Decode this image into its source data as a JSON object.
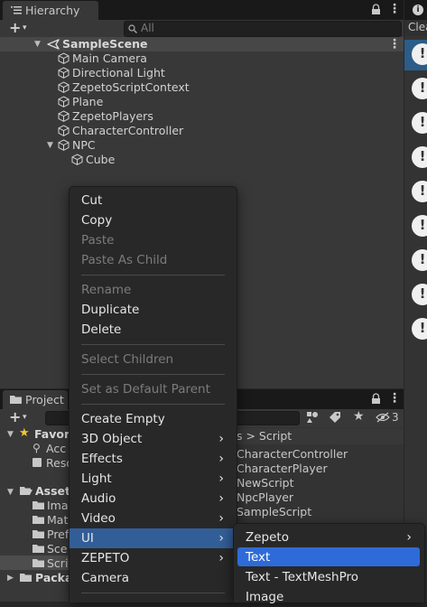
{
  "hierarchy": {
    "tab_label": "Hierarchy",
    "search_placeholder": "All",
    "scene_name": "SampleScene",
    "objects": [
      "Main Camera",
      "Directional Light",
      "ZepetoScriptContext",
      "Plane",
      "ZepetoPlayers",
      "CharacterController",
      "NPC",
      "Cube"
    ]
  },
  "inspector": {
    "header_label": "Clea"
  },
  "project": {
    "tab_label": "Project",
    "breadcrumb": "s > Script",
    "badge_count": "3",
    "left_items": [
      "Favori",
      "Acc",
      "Reso",
      "Asset",
      "Imag",
      "Mat",
      "Pref",
      "Sce",
      "Scri",
      "Packa"
    ],
    "files": [
      "CharacterController",
      "CharacterPlayer",
      "NewScript",
      "NpcPlayer",
      "SampleScript"
    ]
  },
  "context_menu": {
    "cut": "Cut",
    "copy": "Copy",
    "paste": "Paste",
    "paste_as_child": "Paste As Child",
    "rename": "Rename",
    "duplicate": "Duplicate",
    "delete": "Delete",
    "select_children": "Select Children",
    "set_default_parent": "Set as Default Parent",
    "create_empty": "Create Empty",
    "object_3d": "3D Object",
    "effects": "Effects",
    "light": "Light",
    "audio": "Audio",
    "video": "Video",
    "ui": "UI",
    "zepeto": "ZEPETO",
    "camera": "Camera"
  },
  "ui_submenu": {
    "zepeto": "Zepeto",
    "text": "Text",
    "text_tmp": "Text - TextMeshPro",
    "image": "Image"
  },
  "colors": {
    "menu_highlight": "#325e98",
    "submenu_highlight": "#2e6bd8",
    "panel": "#383838"
  }
}
